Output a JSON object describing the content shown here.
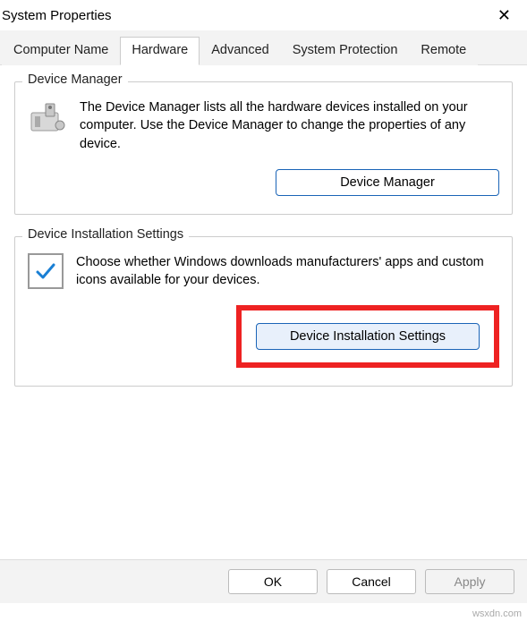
{
  "window": {
    "title": "System Properties"
  },
  "tabs": {
    "computer_name": "Computer Name",
    "hardware": "Hardware",
    "advanced": "Advanced",
    "system_protection": "System Protection",
    "remote": "Remote"
  },
  "device_manager": {
    "legend": "Device Manager",
    "desc": "The Device Manager lists all the hardware devices installed on your computer. Use the Device Manager to change the properties of any device.",
    "button": "Device Manager"
  },
  "install_settings": {
    "legend": "Device Installation Settings",
    "desc": "Choose whether Windows downloads manufacturers' apps and custom icons available for your devices.",
    "button": "Device Installation Settings"
  },
  "dialog_buttons": {
    "ok": "OK",
    "cancel": "Cancel",
    "apply": "Apply"
  },
  "watermark": "wsxdn.com"
}
